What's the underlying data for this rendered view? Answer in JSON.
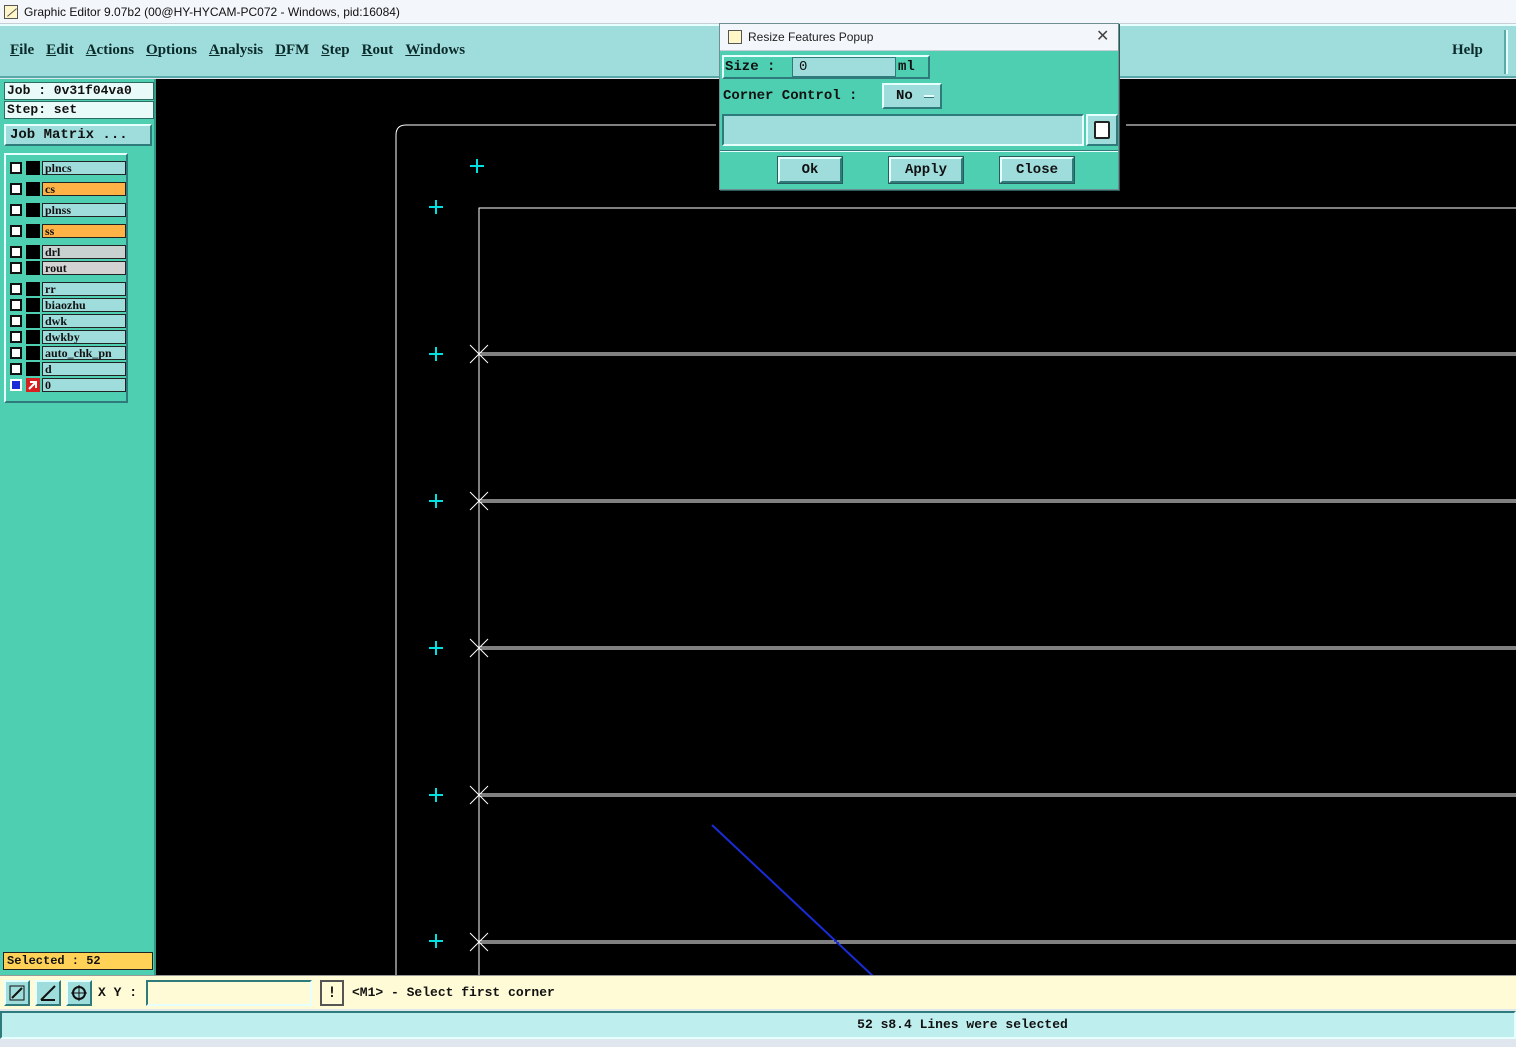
{
  "window": {
    "title": "Graphic Editor 9.07b2 (00@HY-HYCAM-PC072 - Windows, pid:16084)"
  },
  "menubar": {
    "items": [
      "File",
      "Edit",
      "Actions",
      "Options",
      "Analysis",
      "DFM",
      "Step",
      "Rout",
      "Windows"
    ],
    "help": "Help"
  },
  "job": {
    "job_label": "Job : 0v31f04va0",
    "step_label": "Step: set",
    "matrix_button": "Job Matrix ..."
  },
  "layers": [
    {
      "name": "plncs",
      "color": "#9fdcdc"
    },
    {
      "name": "cs",
      "color": "#ffb347"
    },
    {
      "name": "plnss",
      "color": "#9fdcdc"
    },
    {
      "name": "ss",
      "color": "#ffb347"
    },
    {
      "name": "drl",
      "color": "#c8d0d0"
    },
    {
      "name": "rout",
      "color": "#d3d3d3"
    },
    {
      "name": "rr",
      "color": "#9fdcdc"
    },
    {
      "name": "biaozhu",
      "color": "#9fdcdc"
    },
    {
      "name": "dwk",
      "color": "#9fdcdc"
    },
    {
      "name": "dwkby",
      "color": "#9fdcdc"
    },
    {
      "name": "auto_chk_pn",
      "color": "#9fdcdc"
    },
    {
      "name": "d",
      "color": "#9fdcdc"
    },
    {
      "name": "0",
      "color": "#9fdcdc"
    }
  ],
  "selected": "Selected : 52",
  "popup": {
    "title": "Resize Features Popup",
    "size_label": "Size :",
    "size_value": "0",
    "size_unit": "ml",
    "corner_label": "Corner Control :",
    "corner_value": "No",
    "buttons": {
      "ok": "Ok",
      "apply": "Apply",
      "close": "Close"
    }
  },
  "bottom": {
    "xy_label": "X Y :",
    "prompt": "<M1> - Select first corner",
    "excl": "!"
  },
  "status": "52 s8.4 Lines were selected",
  "colors": {
    "panel": "#4fcfb1",
    "menubar": "#9fdcdc",
    "canvas_bg": "#000000",
    "marker": "#00e0e0",
    "arrow": "#1a2bd8"
  }
}
